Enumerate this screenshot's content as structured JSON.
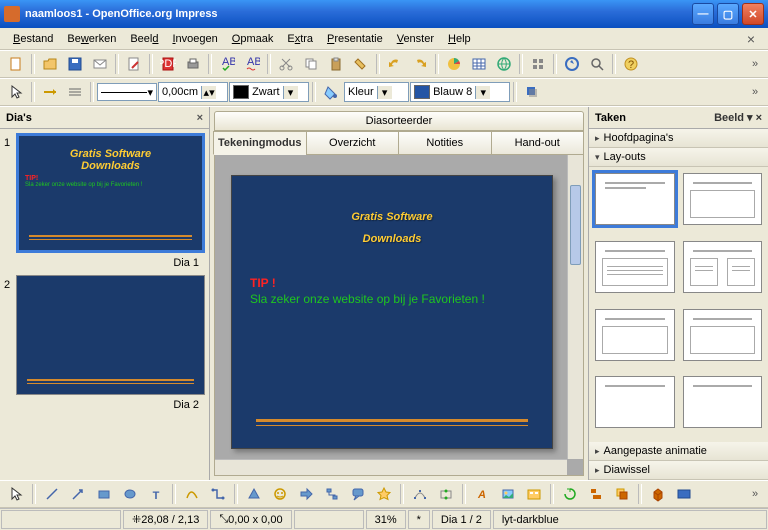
{
  "window": {
    "title": "naamloos1 - OpenOffice.org Impress"
  },
  "menu": {
    "items": [
      "Bestand",
      "Bewerken",
      "Beeld",
      "Invoegen",
      "Opmaak",
      "Extra",
      "Presentatie",
      "Venster",
      "Help"
    ]
  },
  "toolbar2": {
    "widthValue": "0,00cm",
    "colorName": "Zwart",
    "fillMode": "Kleur",
    "fillColor": "Blauw 8"
  },
  "slidesPanel": {
    "title": "Dia's",
    "items": [
      {
        "num": "1",
        "label": "Dia 1",
        "title1": "Gratis Software",
        "title2": "Downloads",
        "tip": "TIP!",
        "body": "Sla zeker onze website op bij je Favorieten !",
        "selected": true
      },
      {
        "num": "2",
        "label": "Dia 2",
        "title1": "",
        "title2": "",
        "tip": "",
        "body": "",
        "selected": false
      }
    ]
  },
  "center": {
    "sorter": "Diasorteerder",
    "tabs": [
      {
        "label": "Tekeningmodus",
        "active": true
      },
      {
        "label": "Overzicht",
        "active": false
      },
      {
        "label": "Notities",
        "active": false
      },
      {
        "label": "Hand-out",
        "active": false
      }
    ],
    "slide": {
      "title1": "Gratis Software",
      "title2": "Downloads",
      "tip": "TIP !",
      "body": "Sla zeker onze website op bij je Favorieten !"
    }
  },
  "tasks": {
    "title": "Taken",
    "viewLabel": "Beeld",
    "sections": {
      "masterPages": "Hoofdpagina's",
      "layouts": "Lay-outs",
      "customAnim": "Aangepaste animatie",
      "slideTrans": "Diawissel"
    }
  },
  "status": {
    "coords": "28,08 / 2,13",
    "size": "0,00 x 0,00",
    "zoom": "31%",
    "modified": "*",
    "slideNum": "Dia 1 / 2",
    "layout": "lyt-darkblue"
  }
}
